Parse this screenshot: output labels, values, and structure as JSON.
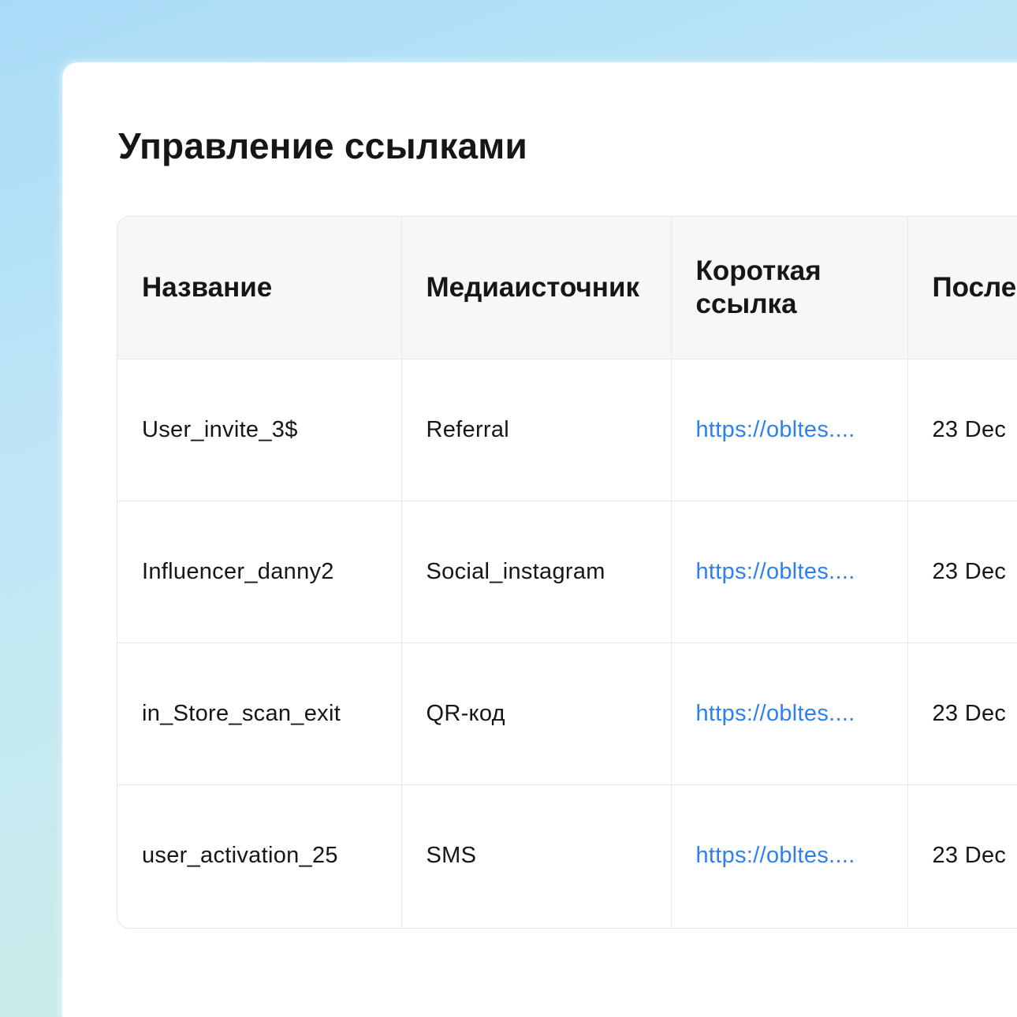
{
  "page": {
    "title": "Управление ссылками"
  },
  "table": {
    "columns": [
      "Название",
      "Медиаисточник",
      "Короткая ссылка",
      "После"
    ],
    "rows": [
      {
        "name": "User_invite_3$",
        "source": "Referral",
        "short_link": "https://obltes....",
        "date": "23 Dec"
      },
      {
        "name": "Influencer_danny2",
        "source": "Social_instagram",
        "short_link": "https://obltes....",
        "date": "23 Dec"
      },
      {
        "name": "in_Store_scan_exit",
        "source": "QR-код",
        "short_link": "https://obltes....",
        "date": "23 Dec"
      },
      {
        "name": "user_activation_25",
        "source": "SMS",
        "short_link": "https://obltes....",
        "date": "23 Dec"
      }
    ]
  },
  "colors": {
    "link": "#2f80ed",
    "header_bg": "#f7f7f7",
    "text": "#161616"
  }
}
